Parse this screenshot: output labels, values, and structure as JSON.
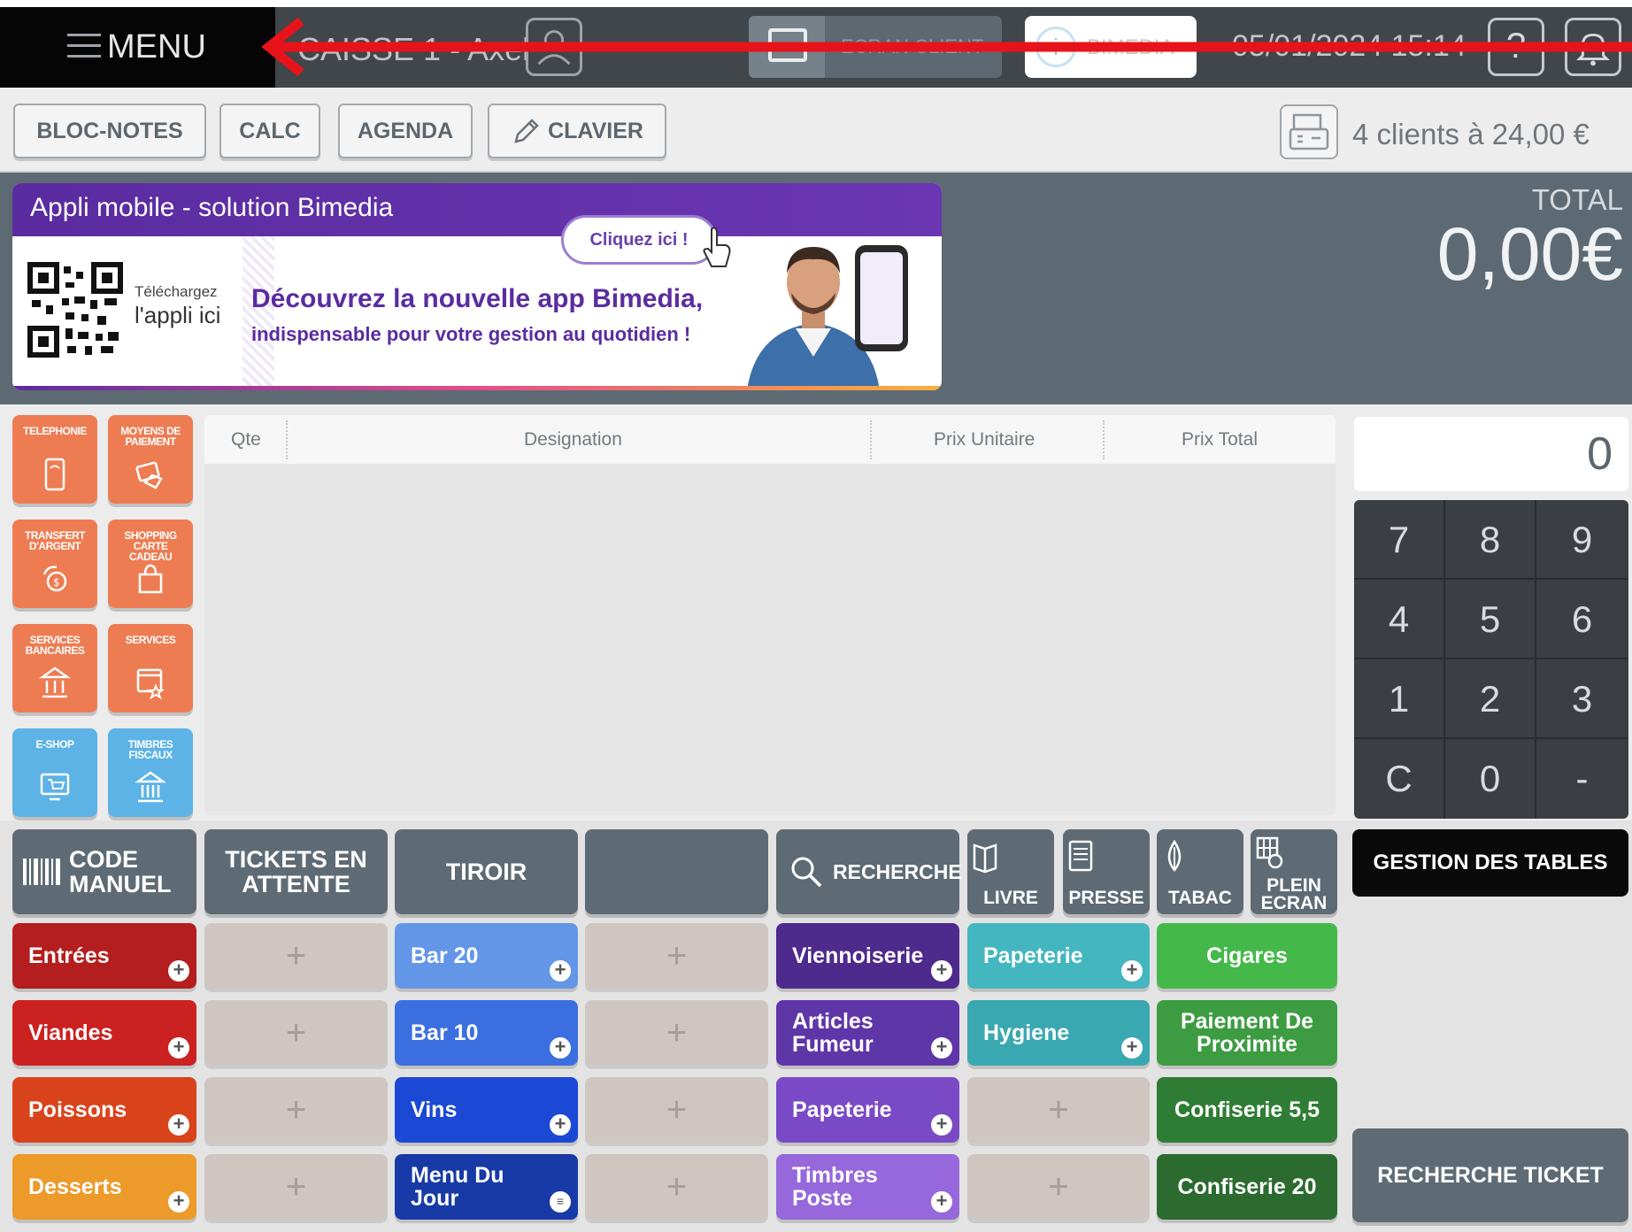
{
  "topbar": {
    "menu_label": "MENU",
    "caisse_name": "CAISSE 1 - Axel",
    "ecran_client_label": "ECRAN CLIENT",
    "bimedia_label": "BIMEDIA",
    "datetime": "05/01/2024 15:14"
  },
  "toolbar": {
    "blocnotes_label": "BLOC-NOTES",
    "calc_label": "CALC",
    "agenda_label": "AGENDA",
    "clavier_label": "CLAVIER",
    "clients_text": "4 clients à 24,00 €"
  },
  "banner": {
    "title": "Appli mobile - solution Bimedia",
    "cta": "Cliquez ici !",
    "qr_line1": "Téléchargez",
    "qr_line2": "l'appli ici",
    "headline": "Découvrez la nouvelle app Bimedia,",
    "subline": "indispensable pour votre gestion au quotidien !"
  },
  "total": {
    "label": "TOTAL",
    "value": "0,00€"
  },
  "function_buttons": [
    {
      "label": "TELEPHONIE",
      "icon": "phone-icon",
      "color": "#ee7c52"
    },
    {
      "label": "MOYENS DE PAIEMENT",
      "icon": "payment-icon",
      "color": "#ee7c52"
    },
    {
      "label": "TRANSFERT D'ARGENT",
      "icon": "money-transfer-icon",
      "color": "#ee7c52"
    },
    {
      "label": "SHOPPING CARTE CADEAU",
      "icon": "gift-card-icon",
      "color": "#ee7c52"
    },
    {
      "label": "SERVICES BANCAIRES",
      "icon": "bank-icon",
      "color": "#ee7c52"
    },
    {
      "label": "SERVICES",
      "icon": "services-icon",
      "color": "#ee7c52"
    },
    {
      "label": "E-SHOP",
      "icon": "eshop-icon",
      "color": "#5db3e6"
    },
    {
      "label": "TIMBRES FISCAUX",
      "icon": "tax-stamp-icon",
      "color": "#5db3e6"
    }
  ],
  "ticket": {
    "columns": [
      "Qte",
      "Designation",
      "Prix Unitaire",
      "Prix Total"
    ]
  },
  "numpad": {
    "display": "0",
    "keys": [
      "7",
      "8",
      "9",
      "4",
      "5",
      "6",
      "1",
      "2",
      "3",
      "C",
      "0",
      "-"
    ]
  },
  "action_buttons": {
    "code_manuel": "CODE MANUEL",
    "tickets_attente": "TICKETS EN ATTENTE",
    "tiroir": "TIROIR",
    "recherche": "RECHERCHE",
    "livre": "LIVRE",
    "presse": "PRESSE",
    "tabac": "TABAC",
    "plein_ecran": "PLEIN ECRAN",
    "gestion_tables": "GESTION DES TABLES",
    "recherche_ticket": "RECHERCHE TICKET"
  },
  "product_columns": [
    [
      {
        "label": "Entrées",
        "color": "#b51e1e",
        "plus": true
      },
      {
        "label": "Viandes",
        "color": "#cc2121",
        "plus": true
      },
      {
        "label": "Poissons",
        "color": "#d9431c",
        "plus": true
      },
      {
        "label": "Desserts",
        "color": "#ec9a2a",
        "plus": true
      }
    ],
    [
      {
        "label": "+",
        "empty": true
      },
      {
        "label": "+",
        "empty": true
      },
      {
        "label": "+",
        "empty": true
      },
      {
        "label": "+",
        "empty": true
      }
    ],
    [
      {
        "label": "Bar 20",
        "color": "#6496e8",
        "plus": true
      },
      {
        "label": "Bar 10",
        "color": "#3b6fe0",
        "plus": true
      },
      {
        "label": "Vins",
        "color": "#1c48d6",
        "plus": true
      },
      {
        "label": "Menu Du Jour",
        "color": "#173aa6",
        "plus": true
      }
    ],
    [
      {
        "label": "+",
        "empty": true
      },
      {
        "label": "+",
        "empty": true
      },
      {
        "label": "+",
        "empty": true
      },
      {
        "label": "+",
        "empty": true
      }
    ],
    [
      {
        "label": "Viennoiserie",
        "color": "#4e2a8c",
        "plus": true
      },
      {
        "label": "Articles Fumeur",
        "color": "#5f36a8",
        "plus": true
      },
      {
        "label": "Papeterie",
        "color": "#7a4ac6",
        "plus": true
      },
      {
        "label": "Timbres Poste",
        "color": "#9668db",
        "plus": true
      }
    ],
    [
      {
        "label": "Papeterie",
        "color": "#44b6bf",
        "plus": true
      },
      {
        "label": "Hygiene",
        "color": "#3aa8b0",
        "plus": true
      },
      {
        "label": "+",
        "empty": true
      },
      {
        "label": "+",
        "empty": true
      }
    ],
    [
      {
        "label": "Cigares",
        "color": "#45b84a",
        "plus": false
      },
      {
        "label": "Paiement De Proximite",
        "color": "#3d9c42",
        "plus": false
      },
      {
        "label": "Confiserie 5,5",
        "color": "#2f7d34",
        "plus": false
      },
      {
        "label": "Confiserie 20",
        "color": "#2b6b30",
        "plus": false
      }
    ]
  ]
}
